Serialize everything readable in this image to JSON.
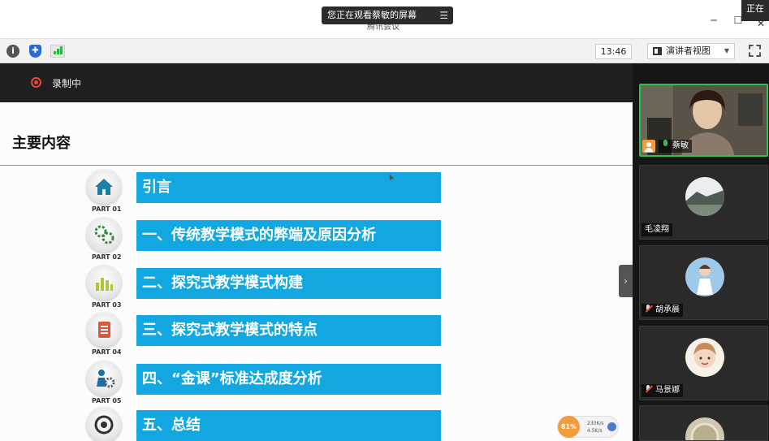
{
  "window": {
    "share_banner": "您正在观看蔡敏的屏幕",
    "banner_menu_icon": "menu-icon",
    "title_ghost": "腾讯会议",
    "corner_label": "正在"
  },
  "toolbar": {
    "clock": "13:46",
    "view_button": "演讲者视图",
    "icons": [
      "info-icon",
      "shield-icon",
      "signal-icon",
      "fullscreen-icon"
    ]
  },
  "recording": {
    "label": "录制中"
  },
  "slide": {
    "title": "主要内容",
    "accent_color": "#12a7e0",
    "parts": [
      {
        "part_no": "PART 01",
        "label": "引言",
        "icon": "home-icon"
      },
      {
        "part_no": "PART 02",
        "label": "一、传统教学模式的弊端及原因分析",
        "icon": "gears-icon"
      },
      {
        "part_no": "PART 03",
        "label": "二、探究式教学模式构建",
        "icon": "bar-chart-icon"
      },
      {
        "part_no": "PART 04",
        "label": "三、探究式教学模式的特点",
        "icon": "notebook-icon"
      },
      {
        "part_no": "PART 05",
        "label": "四、“金课”标准达成度分析",
        "icon": "person-gear-icon"
      },
      {
        "part_no": "",
        "label": "五、总结",
        "icon": "target-icon"
      }
    ]
  },
  "network": {
    "percent": "81%",
    "up": "230K/s",
    "down": "4.5K/s"
  },
  "participants": [
    {
      "name": "蔡敏",
      "mic": "on",
      "host": true
    },
    {
      "name": "毛凌翔",
      "mic": "none"
    },
    {
      "name": "胡承晨",
      "mic": "off"
    },
    {
      "name": "马景娜",
      "mic": "off"
    },
    {
      "name": "",
      "mic": "none"
    }
  ]
}
